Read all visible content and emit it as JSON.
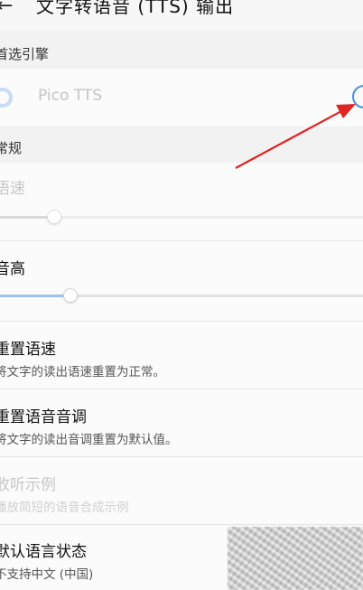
{
  "header": {
    "title": "文字转语音 (TTS) 输出"
  },
  "preferred_engine": {
    "section_label": "首选引擎",
    "engine_name": "Pico TTS"
  },
  "general": {
    "section_label": "常规",
    "speech_rate": {
      "label": "语速",
      "value_fraction": 0.15
    },
    "pitch": {
      "label": "音高",
      "value_fraction": 0.19
    }
  },
  "items": [
    {
      "title": "重置语速",
      "subtitle": "将文字的读出语速重置为正常。"
    },
    {
      "title": "重置语音音调",
      "subtitle": "将文字的读出音调重置为默认值。"
    },
    {
      "title": "收听示例",
      "subtitle": "播放简短的语音合成示例"
    },
    {
      "title": "默认语言状态",
      "subtitle": "不支持中文 (中国)"
    }
  ],
  "colors": {
    "accent": "#4a90d9",
    "annotation_arrow": "#e02424"
  }
}
